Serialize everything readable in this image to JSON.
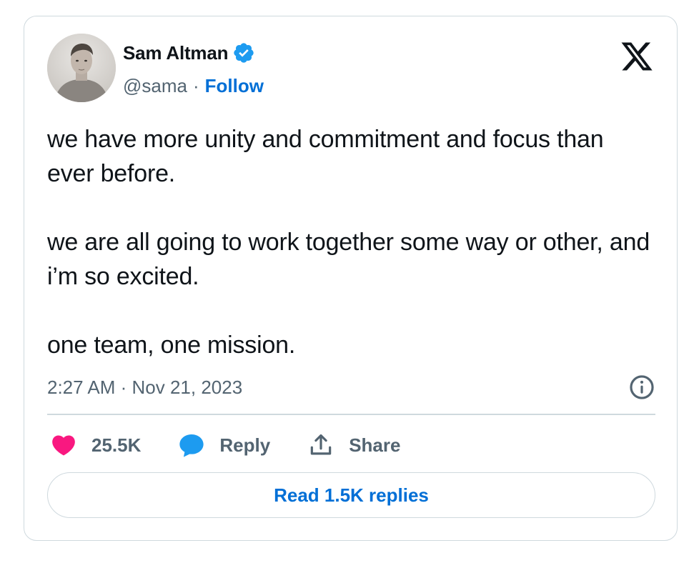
{
  "author": {
    "name": "Sam Altman",
    "handle": "@sama",
    "separator": "·",
    "follow_label": "Follow",
    "verified": true
  },
  "tweet": {
    "paragraphs": [
      "we have more unity and commitment and focus than ever before.",
      "we are all going to work together some way or other, and i’m so excited.",
      "one team, one mission."
    ],
    "timestamp": "2:27 AM · Nov 21, 2023"
  },
  "actions": {
    "like_count": "25.5K",
    "reply_label": "Reply",
    "share_label": "Share",
    "read_replies_label": "Read 1.5K replies"
  },
  "icons": {
    "logo": "x-logo-icon",
    "verified": "verified-badge-icon",
    "info": "info-icon",
    "like": "heart-icon",
    "reply": "reply-bubble-icon",
    "share": "share-icon"
  },
  "colors": {
    "text": "#0f1419",
    "secondary": "#536471",
    "link": "#006fd6",
    "verified": "#1d9bf0",
    "heart": "#f91880",
    "border": "#cfd9de"
  }
}
